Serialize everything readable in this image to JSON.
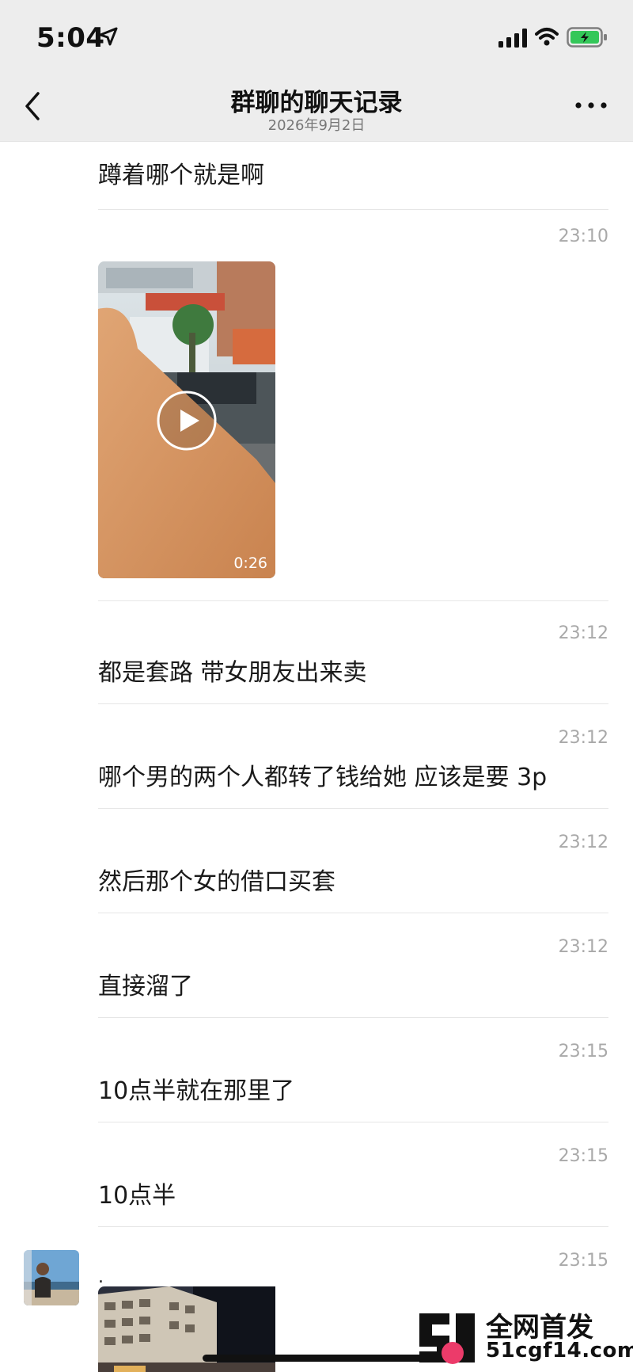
{
  "status_bar": {
    "time": "5:04",
    "icons": [
      "location-arrow-icon",
      "signal-icon",
      "wifi-icon",
      "battery-charging-icon"
    ]
  },
  "nav": {
    "title": "群聊的聊天记录",
    "subtitle": "2026年9月2日",
    "back_icon": "chevron-left-icon",
    "more_icon": "more-dots-icon"
  },
  "messages": [
    {
      "time": "",
      "text": "蹲着哪个就是啊"
    },
    {
      "time": "23:10",
      "type": "video",
      "duration": "0:26"
    },
    {
      "time": "23:12",
      "text": "都是套路 带女朋友出来卖"
    },
    {
      "time": "23:12",
      "text": "哪个男的两个人都转了钱给她 应该是要 3p"
    },
    {
      "time": "23:12",
      "text": "然后那个女的借口买套"
    },
    {
      "time": "23:12",
      "text": "直接溜了"
    },
    {
      "time": "23:15",
      "text": "10点半就在那里了"
    },
    {
      "time": "23:15",
      "text": "10点半"
    },
    {
      "time": "23:15",
      "text": "."
    }
  ],
  "watermark": {
    "line1": "全网首发",
    "line2": "51cgf14.com"
  },
  "colors": {
    "bar_bg": "#ededed",
    "separator": "#e6e6e6",
    "timestamp": "#a9a9a9",
    "battery": "#34c759"
  }
}
